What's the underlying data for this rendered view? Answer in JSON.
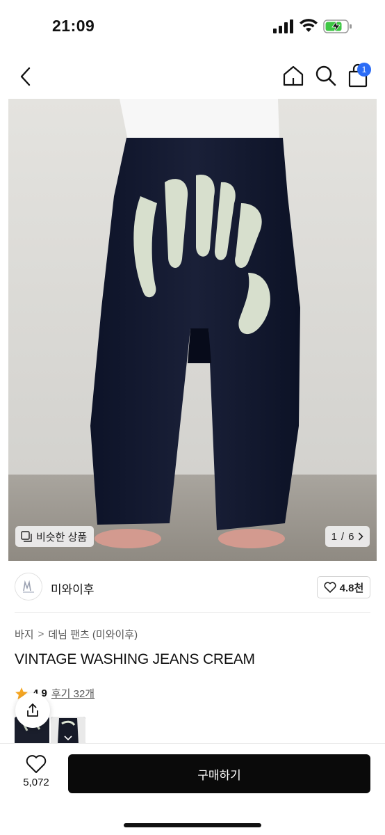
{
  "status_bar": {
    "time": "21:09"
  },
  "top_nav": {
    "cart_count": "1"
  },
  "product_image": {
    "similar_label": "비슷한 상품",
    "page_current": "1",
    "page_total": "6",
    "page_separator": "/"
  },
  "shop": {
    "name": "미와이후",
    "likes": "4.8천"
  },
  "breadcrumb": {
    "category": "바지",
    "subcategory": "데님 팬츠 (미와이후)",
    "separator": ">"
  },
  "product": {
    "title": "VINTAGE WASHING JEANS CREAM"
  },
  "rating": {
    "value": "4.9",
    "reviews": "후기 32개"
  },
  "bottom_bar": {
    "wish_count": "5,072",
    "buy_label": "구매하기"
  },
  "colors": {
    "accent_badge": "#2b6cf6",
    "star": "#f5a623",
    "buy_button": "#0a0a0a"
  }
}
